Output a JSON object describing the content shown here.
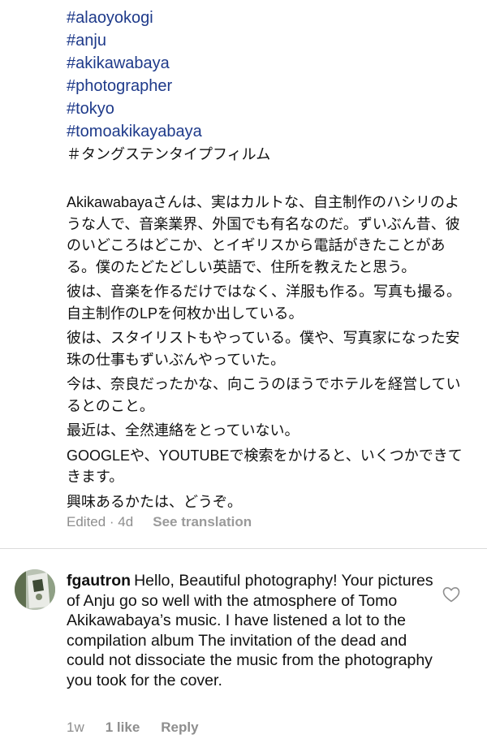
{
  "caption": {
    "hashtags": [
      "#alaoyokogi",
      "#anju",
      "#akikawabaya",
      "#photographer",
      "#tokyo",
      "#tomoakikayabaya"
    ],
    "jp_hashtag": "＃タングステンタイプフィルム",
    "paragraphs": [
      "Akikawabayaさんは、実はカルトな、自主制作のハシリのような人で、音楽業界、外国でも有名なのだ。ずいぶん昔、彼のいどころはどこか、とイギリスから電話がきたことがある。僕のたどたどしい英語で、住所を教えたと思う。",
      "彼は、音楽を作るだけではなく、洋服も作る。写真も撮る。自主制作のLPを何枚か出している。",
      "彼は、スタイリストもやっている。僕や、写真家になった安珠の仕事もずいぶんやっていた。",
      "今は、奈良だったかな、向こうのほうでホテルを経営しているとのこと。",
      "最近は、全然連絡をとっていない。",
      "GOOGLEや、YOUTUBEで検索をかけると、いくつかできてきます。",
      "興味あるかたは、どうぞ。"
    ]
  },
  "caption_meta": {
    "edited": "Edited · 4d",
    "see_translation": "See translation"
  },
  "comment": {
    "username": "fgautron",
    "text": "Hello, Beautiful photography! Your pictures of Anju go so well with the atmosphere of Tomo Akikawabaya’s music. I have listened a lot to the compilation album The invitation of the dead and could not dissociate the music from the photography you took for the cover.",
    "time": "1w",
    "likes": "1 like",
    "reply": "Reply"
  },
  "icons": {
    "like": "heart-outline-icon",
    "avatar": "user-avatar"
  },
  "colors": {
    "hashtag": "#1e3a8a",
    "meta": "#8e8e8e",
    "divider": "#dbdbdb"
  }
}
